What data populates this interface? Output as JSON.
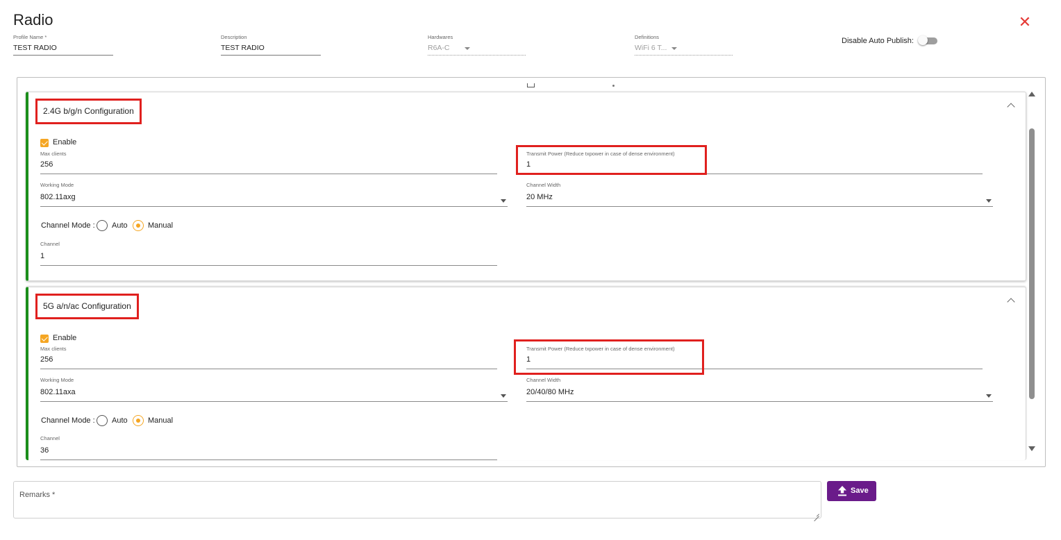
{
  "header": {
    "title": "Radio",
    "close_icon": "close-icon",
    "close_color": "#e53935"
  },
  "top_fields": {
    "profile_name": {
      "label": "Profile Name *",
      "value": "TEST RADIO"
    },
    "description": {
      "label": "Description",
      "value": "TEST RADIO"
    },
    "hardwares": {
      "label": "Hardwares",
      "value": "R6A-C"
    },
    "definitions": {
      "label": "Definitions",
      "value": "WiFi 6 T..."
    },
    "auto_publish": {
      "label": "Disable Auto Publish:",
      "enabled": false
    }
  },
  "sections": {
    "band_24": {
      "title": "2.4G b/g/n Configuration",
      "enable_label": "Enable",
      "enabled": true,
      "max_clients": {
        "label": "Max clients",
        "value": "256"
      },
      "transmit_power": {
        "label": "Transmit Power (Reduce txpower in case of dense environment)",
        "value": "1"
      },
      "working_mode": {
        "label": "Working Mode",
        "value": "802.11axg"
      },
      "channel_width": {
        "label": "Channel Width",
        "value": "20 MHz"
      },
      "channel_mode": {
        "label": "Channel Mode :",
        "options": [
          "Auto",
          "Manual"
        ],
        "selected": "Manual"
      },
      "channel": {
        "label": "Channel",
        "value": "1"
      }
    },
    "band_5": {
      "title": "5G a/n/ac Configuration",
      "enable_label": "Enable",
      "enabled": true,
      "max_clients": {
        "label": "Max clients",
        "value": "256"
      },
      "transmit_power": {
        "label": "Transmit Power (Reduce txpower in case of dense environment)",
        "value": "1"
      },
      "working_mode": {
        "label": "Working Mode",
        "value": "802.11axa"
      },
      "channel_width": {
        "label": "Channel Width",
        "value": "20/40/80 MHz"
      },
      "channel_mode": {
        "label": "Channel Mode :",
        "options": [
          "Auto",
          "Manual"
        ],
        "selected": "Manual"
      },
      "channel": {
        "label": "Channel",
        "value": "36"
      }
    }
  },
  "footer": {
    "remarks_label": "Remarks *",
    "save_label": "Save",
    "save_icon": "upload-icon",
    "save_color": "#6a1b8a"
  },
  "colors": {
    "accent": "#f5a623",
    "section_bar": "#1b8e1b",
    "highlight": "#e0201e"
  }
}
